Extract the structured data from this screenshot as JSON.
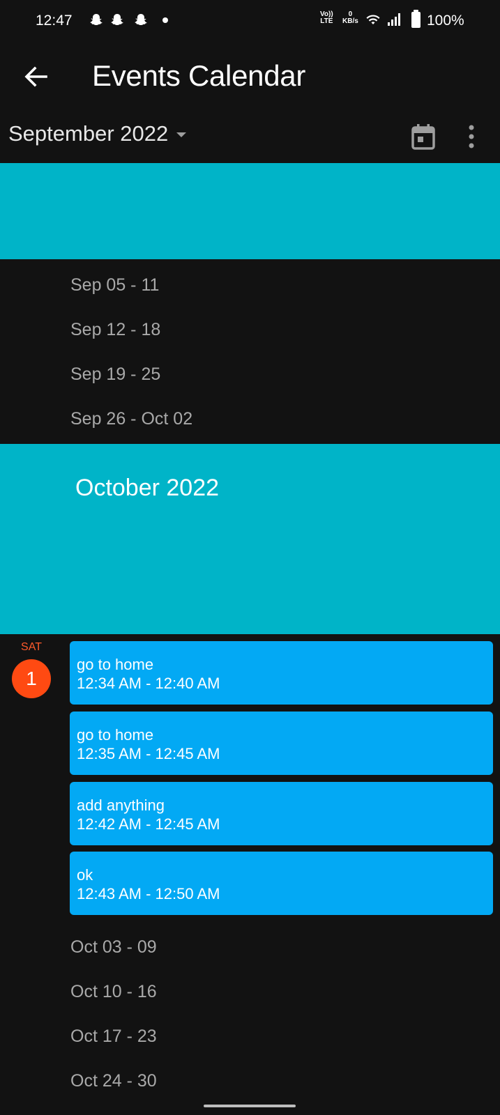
{
  "status_bar": {
    "time": "12:47",
    "volte_line1": "Vo))",
    "volte_line2": "LTE",
    "speed_value": "0",
    "speed_unit": "KB/s",
    "battery": "100%",
    "icons": [
      "snapchat-icon",
      "snapchat-icon",
      "snapchat-icon",
      "notification-dot",
      "wifi-icon",
      "signal-icon",
      "battery-icon"
    ]
  },
  "app_bar": {
    "title": "Events Calendar",
    "back_icon": "arrow-back-icon"
  },
  "toolbar": {
    "month_selector": "September 2022",
    "calendar_icon": "calendar-today-icon",
    "more_icon": "more-vert-icon"
  },
  "sections": {
    "september_weeks": [
      "Sep 05 - 11",
      "Sep 12 - 18",
      "Sep 19 - 25",
      "Sep 26 - Oct 02"
    ],
    "october_title": "October 2022",
    "day": {
      "name": "SAT",
      "number": "1"
    },
    "events": [
      {
        "title": "go to home",
        "time": "12:34 AM - 12:40 AM"
      },
      {
        "title": "go to home",
        "time": "12:35 AM - 12:45 AM"
      },
      {
        "title": "add anything",
        "time": "12:42 AM - 12:45 AM"
      },
      {
        "title": "ok",
        "time": "12:43 AM - 12:50 AM"
      }
    ],
    "october_weeks": [
      "Oct 03 - 09",
      "Oct 10 - 16",
      "Oct 17 - 23",
      "Oct 24 - 30"
    ]
  },
  "colors": {
    "background": "#121212",
    "month_band": "#00b4c8",
    "event_card": "#03a9f4",
    "day_badge": "#ff4a12",
    "week_text": "#a9a9a9"
  }
}
